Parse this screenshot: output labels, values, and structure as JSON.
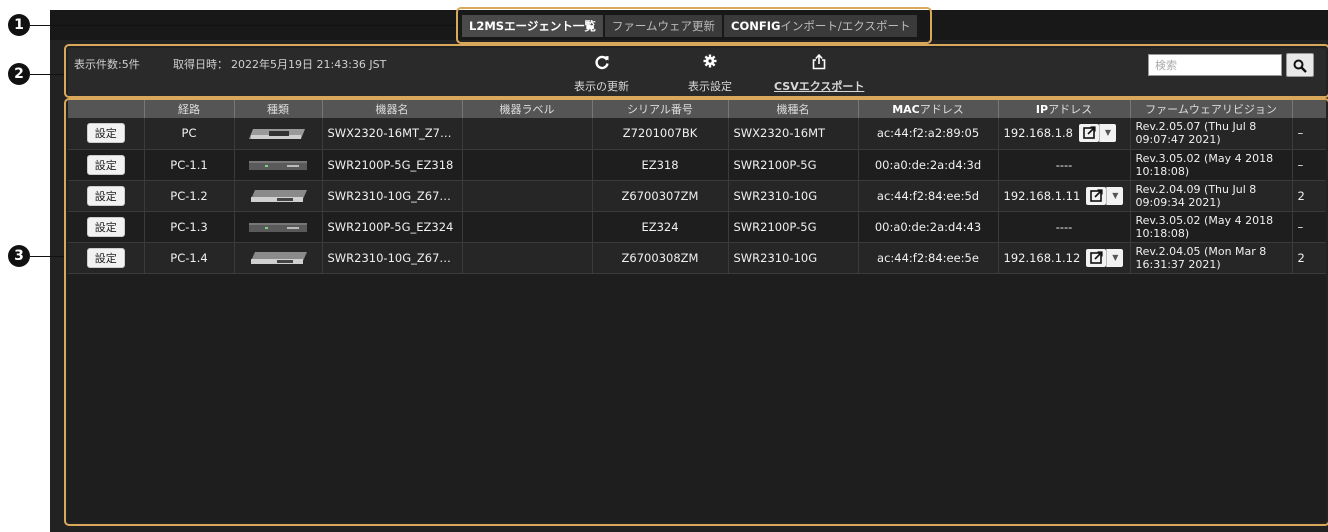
{
  "callouts": [
    "1",
    "2",
    "3"
  ],
  "tabs": [
    {
      "bold": "L2MS",
      "rest": "エージェント一覧",
      "active": true
    },
    {
      "bold": "",
      "rest": "ファームウェア更新",
      "active": false
    },
    {
      "bold": "CONFIG",
      "rest": "インポート/エクスポート",
      "active": false
    }
  ],
  "toolbar": {
    "count_label": "表示件数:5件",
    "date_label": "取得日時：",
    "date_value": "2022年5月19日 21:43:36 JST",
    "refresh_label": "表示の更新",
    "settings_label": "表示設定",
    "export_label": "CSVエクスポート",
    "search_placeholder": "検索"
  },
  "table": {
    "headers": [
      "",
      "経路",
      "種類",
      "機器名",
      "機器ラベル",
      "シリアル番号",
      "機種名",
      "MACアドレス",
      "IPアドレス",
      "ファームウェアリビジョン",
      ""
    ],
    "setting_label": "設定",
    "rows": [
      {
        "route": "PC",
        "device_type": "switch-large",
        "name": "SWX2320-16MT_Z7…",
        "label": "",
        "serial": "Z7201007BK",
        "model": "SWX2320-16MT",
        "mac": "ac:44:f2:a2:89:05",
        "ip": "192.168.1.8",
        "fw": "Rev.2.05.07 (Thu Jul  8 09:07:47 2021)",
        "extra": "–"
      },
      {
        "route": "PC-1.1",
        "device_type": "switch-small",
        "name": "SWR2100P-5G_EZ318",
        "label": "",
        "serial": "EZ318",
        "model": "SWR2100P-5G",
        "mac": "00:a0:de:2a:d4:3d",
        "ip": "----",
        "fw": "Rev.3.05.02 (May  4 2018 10:18:08)",
        "extra": "–"
      },
      {
        "route": "PC-1.2",
        "device_type": "switch-medium",
        "name": "SWR2310-10G_Z67…",
        "label": "",
        "serial": "Z6700307ZM",
        "model": "SWR2310-10G",
        "mac": "ac:44:f2:84:ee:5d",
        "ip": "192.168.1.11",
        "fw": "Rev.2.04.09 (Thu Jul  8 09:09:34 2021)",
        "extra": "2"
      },
      {
        "route": "PC-1.3",
        "device_type": "switch-small",
        "name": "SWR2100P-5G_EZ324",
        "label": "",
        "serial": "EZ324",
        "model": "SWR2100P-5G",
        "mac": "00:a0:de:2a:d4:43",
        "ip": "----",
        "fw": "Rev.3.05.02 (May  4 2018 10:18:08)",
        "extra": "–"
      },
      {
        "route": "PC-1.4",
        "device_type": "switch-medium",
        "name": "SWR2310-10G_Z67…",
        "label": "",
        "serial": "Z6700308ZM",
        "model": "SWR2310-10G",
        "mac": "ac:44:f2:84:ee:5e",
        "ip": "192.168.1.12",
        "fw": "Rev.2.04.05 (Mon Mar  8 16:31:37 2021)",
        "extra": "2"
      }
    ]
  },
  "colors": {
    "highlight": "#d9a85a",
    "header_bg": "#555555",
    "frame_bg": "#222222"
  }
}
